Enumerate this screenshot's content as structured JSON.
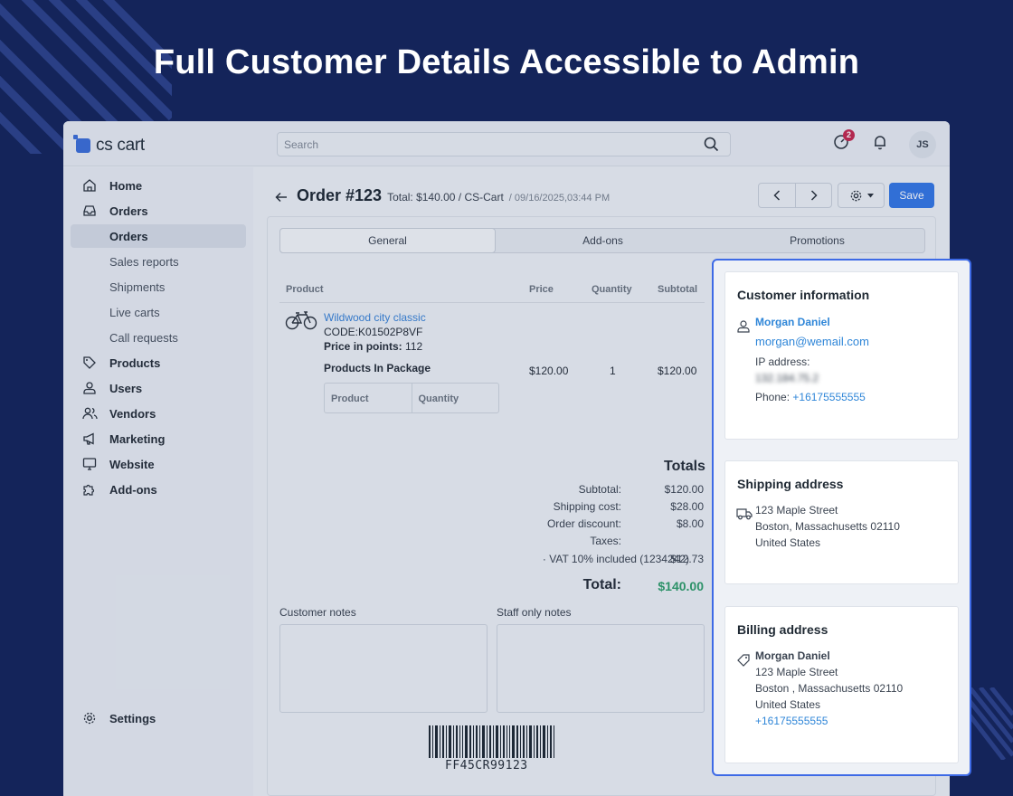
{
  "headline": "Full Customer Details Accessible to Admin",
  "colors": {
    "background": "#14245a",
    "accent": "#3578e5",
    "highlight_border": "#3d6ae6",
    "total_green": "#2f9e6a",
    "link_blue": "#3a83d6"
  },
  "app": {
    "logo_text": "cs cart",
    "search_placeholder": "Search",
    "notifications_badge": "2",
    "avatar_initials": "JS"
  },
  "sidebar": {
    "items": [
      {
        "label": "Home",
        "icon": "home-icon"
      },
      {
        "label": "Orders",
        "icon": "inbox-icon"
      },
      {
        "label": "Orders"
      },
      {
        "label": "Sales reports"
      },
      {
        "label": "Shipments"
      },
      {
        "label": "Live carts"
      },
      {
        "label": "Call requests"
      },
      {
        "label": "Products",
        "icon": "tag-icon"
      },
      {
        "label": "Users",
        "icon": "user-icon"
      },
      {
        "label": "Vendors",
        "icon": "users-icon"
      },
      {
        "label": "Marketing",
        "icon": "megaphone-icon"
      },
      {
        "label": "Website",
        "icon": "monitor-icon"
      },
      {
        "label": "Add-ons",
        "icon": "puzzle-icon"
      }
    ],
    "settings_label": "Settings"
  },
  "order": {
    "title": "Order #123",
    "total_text": "Total: $140.00 / CS-Cart",
    "date_text": "/ 09/16/2025,03:44 PM",
    "save_label": "Save",
    "tabs": [
      "General",
      "Add-ons",
      "Promotions"
    ],
    "columns": {
      "product": "Product",
      "price": "Price",
      "quantity": "Quantity",
      "subtotal": "Subtotal"
    },
    "product": {
      "name": "Wildwood city classic",
      "code": "CODE:K01502P8VF",
      "points_label": "Price in points:",
      "points_value": "112",
      "package_label": "Products In Package",
      "package_columns": [
        "Product",
        "Quantity"
      ],
      "price": "$120.00",
      "quantity": "1",
      "subtotal": "$120.00"
    },
    "totals": {
      "title": "Totals",
      "rows": [
        {
          "label": "Subtotal:",
          "value": "$120.00"
        },
        {
          "label": "Shipping cost:",
          "value": "$28.00"
        },
        {
          "label": "Order discount:",
          "value": "$8.00"
        },
        {
          "label": "Taxes:",
          "value": ""
        },
        {
          "label": "· VAT 10% included (1234242)",
          "value": "$12.73"
        }
      ],
      "grand_label": "Total:",
      "grand_value": "$140.00"
    },
    "customer_notes_label": "Customer notes",
    "staff_notes_label": "Staff only notes",
    "barcode_text": "FF45CR99123"
  },
  "customer": {
    "title": "Customer information",
    "name": "Morgan Daniel",
    "email": "morgan@wemail.com",
    "ip_label": "IP address:",
    "ip_value": "132.184.75.2",
    "phone_label": "Phone:",
    "phone_value": "+16175555555"
  },
  "shipping": {
    "title": "Shipping address",
    "line1": "123 Maple Street",
    "line2": "Boston, Massachusetts 02110",
    "line3": "United States"
  },
  "billing": {
    "title": "Billing address",
    "name": "Morgan Daniel",
    "line1": "123 Maple Street",
    "line2": "Boston , Massachusetts 02110",
    "line3": "United States",
    "phone": "+16175555555"
  }
}
